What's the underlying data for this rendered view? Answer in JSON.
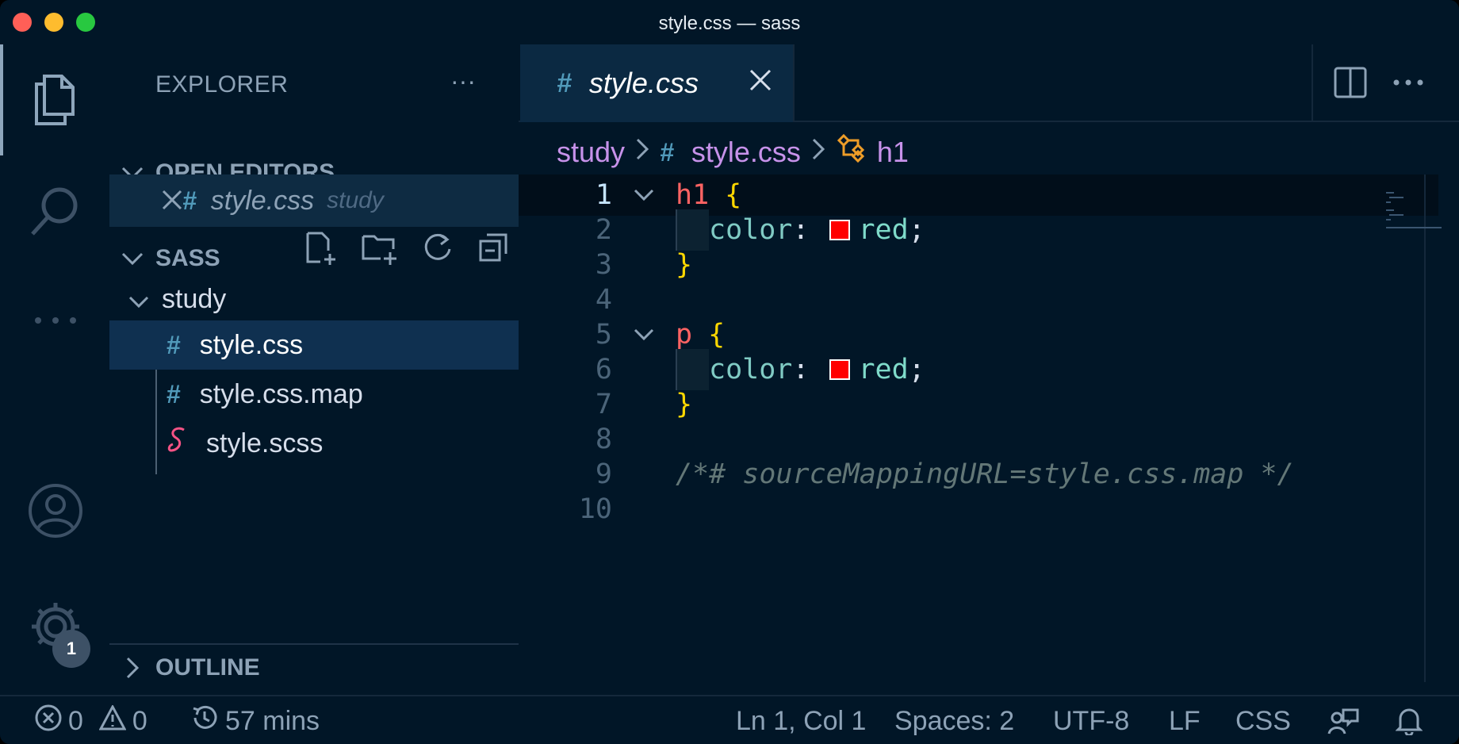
{
  "window": {
    "title": "style.css — sass"
  },
  "activity_bar": {
    "icons": [
      "files-icon",
      "search-icon",
      "more-icon",
      "account-icon",
      "settings-gear-icon"
    ],
    "settings_badge": "1"
  },
  "sidebar": {
    "title": "EXPLORER",
    "open_editors": {
      "label": "OPEN EDITORS",
      "items": [
        {
          "name": "style.css",
          "folder": "study"
        }
      ]
    },
    "workspace": {
      "label": "SASS",
      "folder": "study",
      "files": [
        {
          "name": "style.css",
          "icon": "#"
        },
        {
          "name": "style.css.map",
          "icon": "#"
        },
        {
          "name": "style.scss",
          "icon": "sass-icon"
        }
      ]
    },
    "outline_label": "OUTLINE"
  },
  "editor": {
    "tab": {
      "label": "style.css",
      "icon": "#"
    },
    "breadcrumb": {
      "folder": "study",
      "file_icon": "#",
      "file": "style.css",
      "symbol": "h1"
    },
    "lines": {
      "l1": {
        "num": "1",
        "sel": "h1",
        "brace": "{"
      },
      "l2": {
        "num": "2",
        "prop": "color",
        "colon": ":",
        "value": "red",
        "semi": ";"
      },
      "l3": {
        "num": "3",
        "brace": "}"
      },
      "l4": {
        "num": "4"
      },
      "l5": {
        "num": "5",
        "sel": "p",
        "brace": "{"
      },
      "l6": {
        "num": "6",
        "prop": "color",
        "colon": ":",
        "value": "red",
        "semi": ";"
      },
      "l7": {
        "num": "7",
        "brace": "}"
      },
      "l8": {
        "num": "8"
      },
      "l9": {
        "num": "9",
        "comment": "/*# sourceMappingURL=style.css.map */"
      },
      "l10": {
        "num": "10"
      }
    },
    "swatch_color": "#ff0000"
  },
  "statusbar": {
    "errors": "0",
    "warnings": "0",
    "time": "57 mins",
    "position": "Ln 1, Col 1",
    "spaces": "Spaces: 2",
    "encoding": "UTF-8",
    "eol": "LF",
    "language": "CSS"
  }
}
